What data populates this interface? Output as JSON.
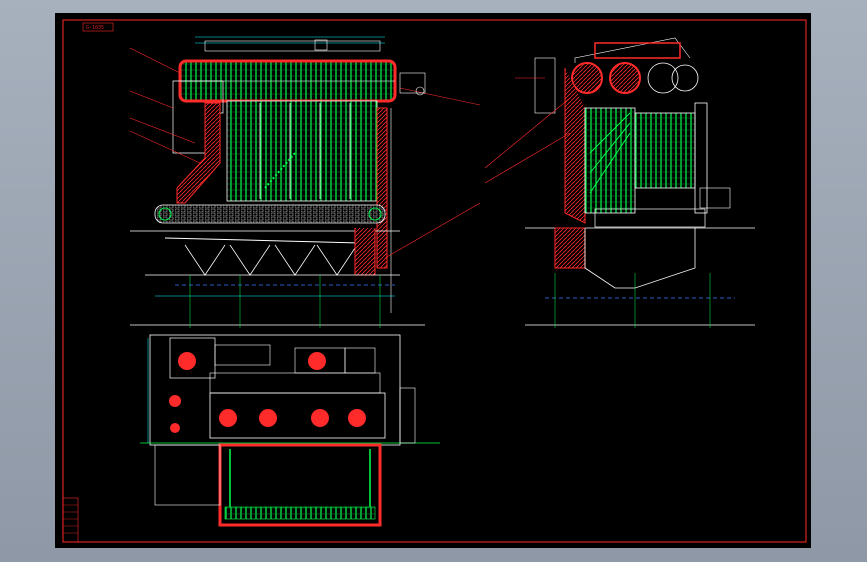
{
  "drawing": {
    "sheet_code": "G-1035",
    "colors": {
      "background": "#000000",
      "viewport": "#96a0ae",
      "border": "#ff2a2a",
      "tube": "#00ff4c",
      "dimension": "#00ffff",
      "outline": "#ffffff",
      "refractory": "#ff0000",
      "text": "#e02020"
    },
    "views": [
      "front-section-view",
      "side-section-view",
      "plan-view"
    ]
  }
}
